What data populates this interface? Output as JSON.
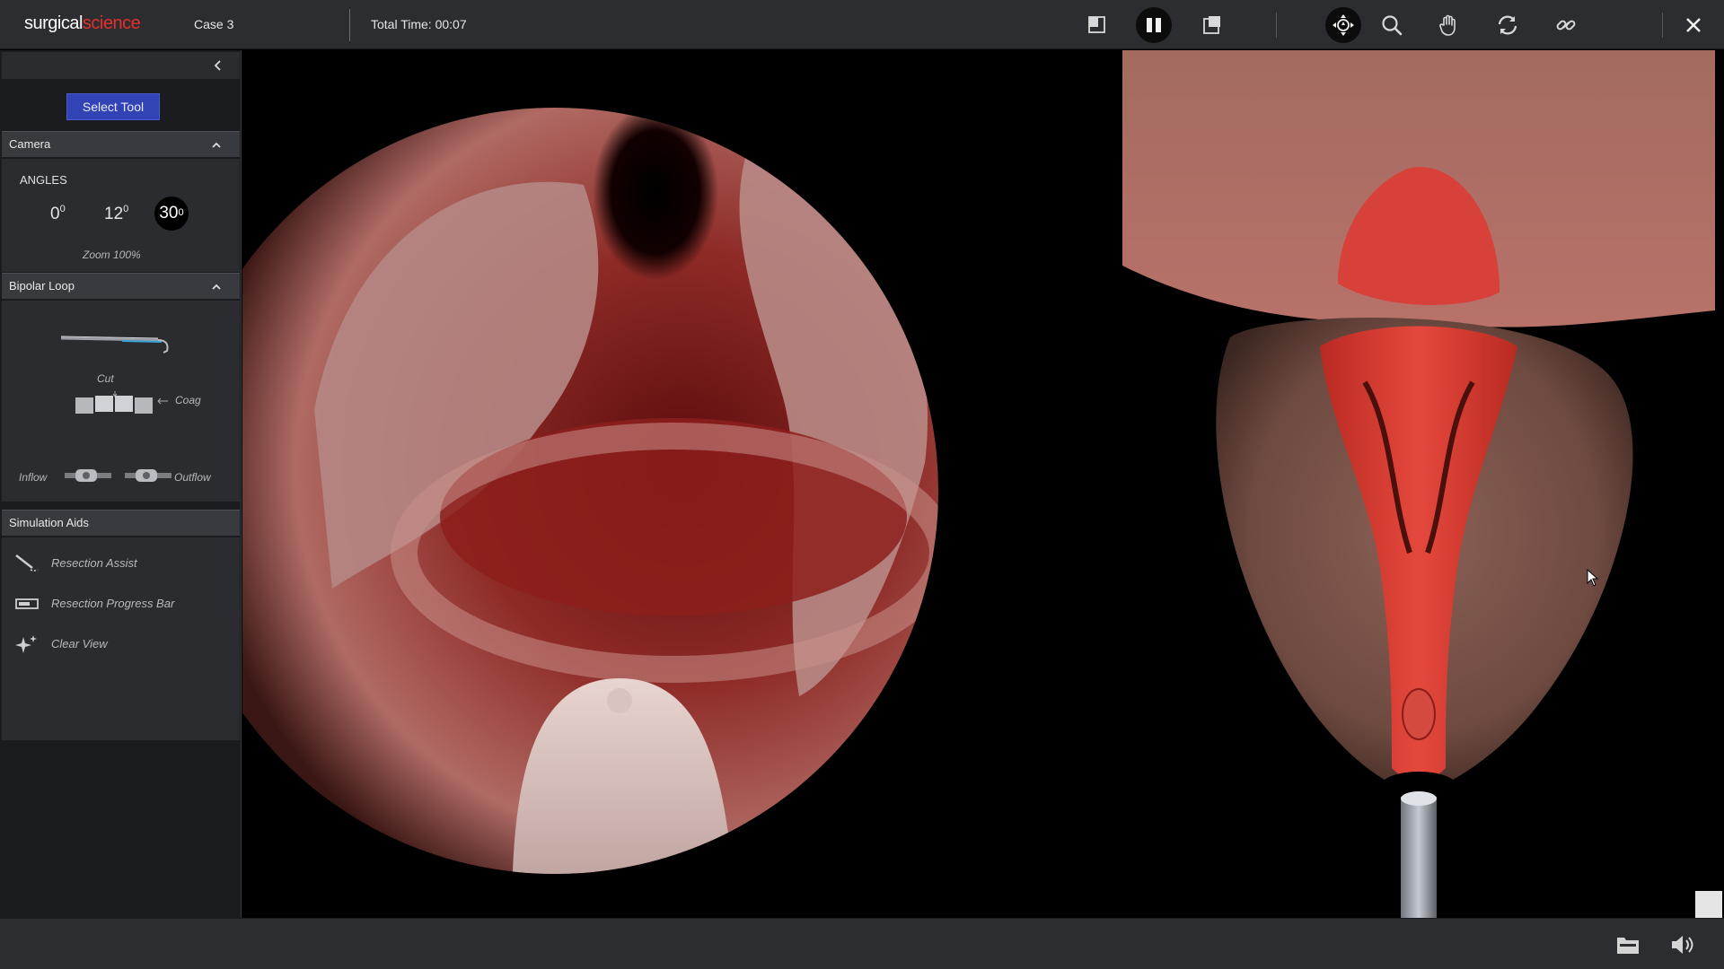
{
  "app": {
    "brand_part1": "surgical",
    "brand_part2": "science",
    "case_label": "Case 3",
    "total_time": "Total Time: 00:07"
  },
  "toolbar": {
    "left_icons": [
      "view-layout-left-icon",
      "pause-icon",
      "view-layout-right-icon"
    ],
    "right_icons": [
      "move-camera-icon",
      "zoom-search-icon",
      "grab-hand-icon",
      "rotate-icon",
      "link-icon"
    ],
    "close_icon": "close-icon"
  },
  "sidebar": {
    "select_tool_label": "Select Tool",
    "camera": {
      "title": "Camera",
      "angles_title": "ANGLES",
      "angles": [
        {
          "value": "0",
          "unit": "0"
        },
        {
          "value": "12",
          "unit": "0"
        },
        {
          "value": "30",
          "unit": "0"
        }
      ],
      "active_angle_index": 2,
      "zoom_label": "Zoom 100%"
    },
    "bipolar": {
      "title": "Bipolar Loop",
      "cut_label": "Cut",
      "coag_label": "Coag",
      "inflow_label": "Inflow",
      "outflow_label": "Outflow"
    },
    "aids": {
      "title": "Simulation Aids",
      "items": [
        {
          "label": "Resection Assist",
          "icon": "resection-assist-icon"
        },
        {
          "label": "Resection Progress Bar",
          "icon": "progress-bar-icon"
        },
        {
          "label": "Clear View",
          "icon": "sparkle-icon"
        }
      ]
    }
  },
  "bottom": {
    "icons": [
      "folder-icon",
      "volume-icon"
    ]
  },
  "colors": {
    "brand_red": "#e5302c",
    "accent_blue": "#3143b5",
    "panel_dark": "#1b1c1f",
    "panel_mid": "#2a2c30",
    "bar": "#2b2d31"
  }
}
